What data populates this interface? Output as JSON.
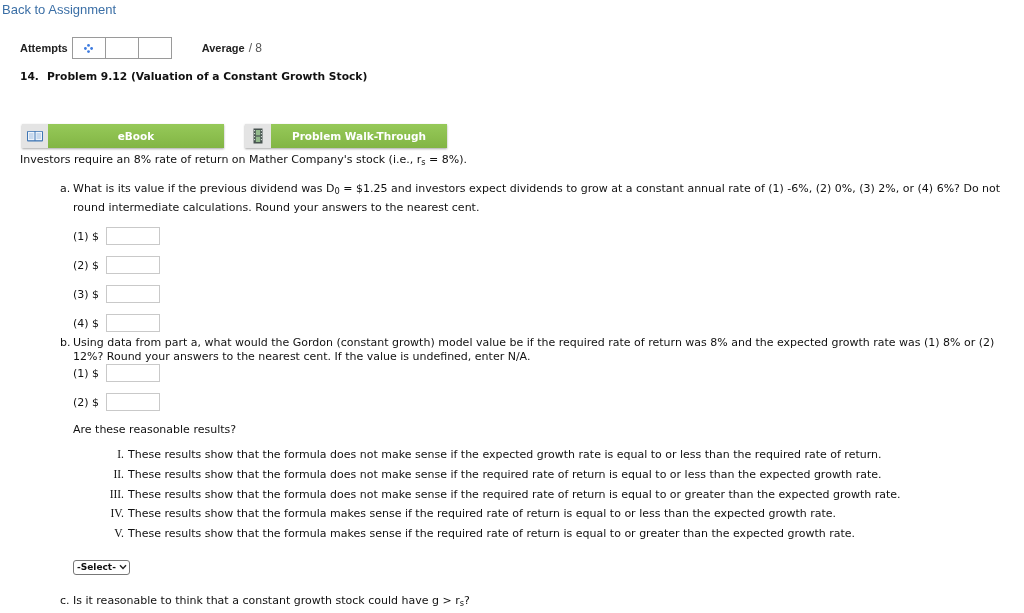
{
  "back_link": {
    "label": "Back to Assignment"
  },
  "attempts": {
    "label": "Attempts",
    "boxes": [
      {
        "kind": "loading"
      },
      {
        "kind": "empty"
      },
      {
        "kind": "empty"
      }
    ]
  },
  "average": {
    "label": "Average",
    "value": "/ 8"
  },
  "problem": {
    "number": "14.",
    "title": "Problem 9.12 (Valuation of a Constant Growth Stock)"
  },
  "resources": [
    {
      "kind": "book",
      "label": "eBook"
    },
    {
      "kind": "film",
      "label": "Problem Walk-Through"
    }
  ],
  "intro": "Investors require an 8% rate of return on Mather Company's stock (i.e., r$_{s}$ = 8%).",
  "parts": [
    {
      "letter": "a.",
      "question": "What is its value if the previous dividend was D$_{0}$ = $1.25 and investors expect dividends to grow at a constant annual rate of (1) -6%, (2) 0%, (3) 2%, or (4) 6%? Do not round intermediate calculations. Round your answers to the nearest cent.",
      "answers": [
        {
          "label": "(1) $"
        },
        {
          "label": "(2) $"
        },
        {
          "label": "(3) $"
        },
        {
          "label": "(4) $"
        }
      ]
    },
    {
      "letter": "b.",
      "question": "Using data from part a, what would the Gordon (constant growth) model value be if the required rate of return was 8% and the expected growth rate was (1) 8% or (2) 12%? Round your answers to the nearest cent. If the value is undefined, enter N/A.",
      "answers": [
        {
          "label": "(1) $"
        },
        {
          "label": "(2) $"
        }
      ],
      "follow_up": "Are these reasonable results?",
      "choices": [
        {
          "numeral": "I.",
          "text": "These results show that the formula does not make sense if the expected growth rate is equal to or less than the required rate of return."
        },
        {
          "numeral": "II.",
          "text": "These results show that the formula does not make sense if the required rate of return is equal to or less than the expected growth rate."
        },
        {
          "numeral": "III.",
          "text": "These results show that the formula does not make sense if the required rate of return is equal to or greater than the expected growth rate."
        },
        {
          "numeral": "IV.",
          "text": "These results show that the formula makes sense if the required rate of return is equal to or less than the expected growth rate."
        },
        {
          "numeral": "V.",
          "text": "These results show that the formula makes sense if the required rate of return is equal to or greater than the expected growth rate."
        }
      ],
      "select": {
        "value": "-Select-"
      }
    },
    {
      "letter": "c.",
      "question": "Is it reasonable to think that a constant growth stock could have g > r$_{s}$?"
    }
  ]
}
